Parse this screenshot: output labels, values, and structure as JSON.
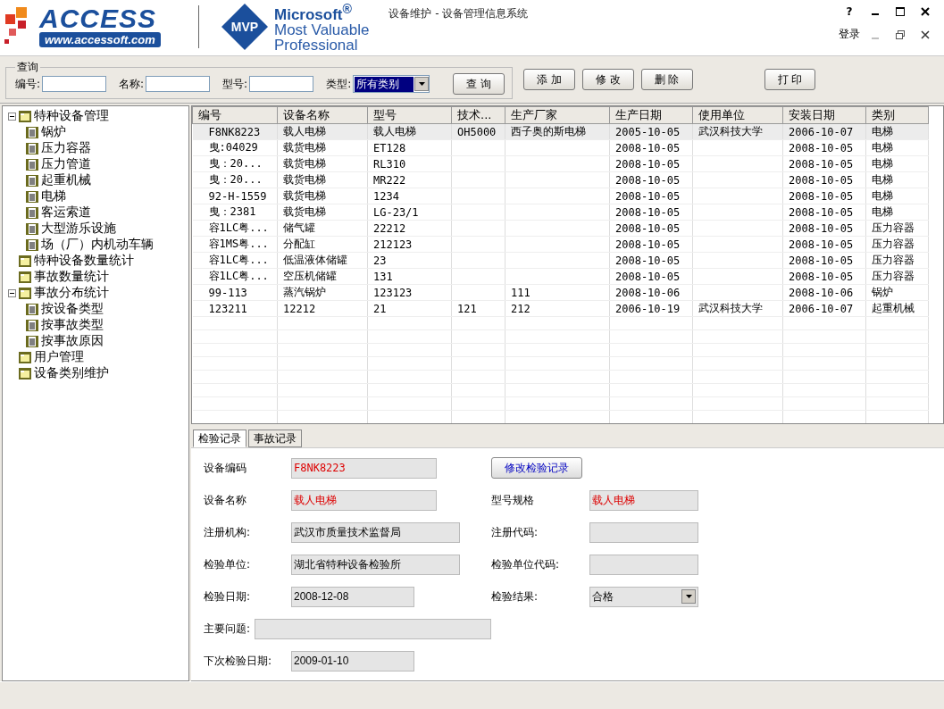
{
  "header": {
    "access_logo": {
      "name": "ACCESS",
      "url": "www.accessoft.com"
    },
    "mvp_logo": {
      "badge": "MVP",
      "lines": [
        "Microsoft$^{®}$",
        "Most Valuable",
        "Professional"
      ]
    },
    "title": "设备维护 - 设备管理信息系统",
    "help": "?",
    "login": "登录"
  },
  "query": {
    "legend": "查询",
    "fields": [
      {
        "label": "编号:",
        "kind": "input"
      },
      {
        "label": "名称:",
        "kind": "input"
      },
      {
        "label": "型号:",
        "kind": "input"
      },
      {
        "label": "类型:",
        "kind": "select",
        "value": "所有类别"
      }
    ],
    "search_button": "查 询"
  },
  "actions": [
    "添 加",
    "修 改",
    "删 除"
  ],
  "print_button": "打 印",
  "tree": [
    {
      "label": "特种设备管理",
      "expanded": true,
      "children": [
        {
          "label": "锅炉"
        },
        {
          "label": "压力容器"
        },
        {
          "label": "压力管道"
        },
        {
          "label": "起重机械"
        },
        {
          "label": "电梯"
        },
        {
          "label": "客运索道"
        },
        {
          "label": "大型游乐设施"
        },
        {
          "label": "场（厂）内机动车辆"
        }
      ]
    },
    {
      "label": "特种设备数量统计"
    },
    {
      "label": "事故数量统计"
    },
    {
      "label": "事故分布统计",
      "expanded": true,
      "children": [
        {
          "label": "按设备类型"
        },
        {
          "label": "按事故类型"
        },
        {
          "label": "按事故原因"
        }
      ]
    },
    {
      "label": "用户管理"
    },
    {
      "label": "设备类别维护"
    }
  ],
  "table": {
    "columns": [
      "编号",
      "设备名称",
      "型号",
      "技术...",
      "生产厂家",
      "生产日期",
      "使用单位",
      "安装日期",
      "类别"
    ],
    "rows": [
      {
        "selected": true,
        "cells": [
          "F8NK8223",
          "载人电梯",
          "载人电梯",
          "OH5000",
          "西子奥的斯电梯",
          "2005-10-05",
          "武汉科技大学",
          "2006-10-07",
          "电梯"
        ]
      },
      {
        "selected": false,
        "cells": [
          "曳:04029",
          "载货电梯",
          "ET128",
          "",
          "",
          "2008-10-05",
          "",
          "2008-10-05",
          "电梯"
        ]
      },
      {
        "selected": false,
        "cells": [
          "曳：20...",
          "载货电梯",
          "RL310",
          "",
          "",
          "2008-10-05",
          "",
          "2008-10-05",
          "电梯"
        ]
      },
      {
        "selected": false,
        "cells": [
          "曳：20...",
          "载货电梯",
          "MR222",
          "",
          "",
          "2008-10-05",
          "",
          "2008-10-05",
          "电梯"
        ]
      },
      {
        "selected": false,
        "cells": [
          "92-H-1559",
          "载货电梯",
          "1234",
          "",
          "",
          "2008-10-05",
          "",
          "2008-10-05",
          "电梯"
        ]
      },
      {
        "selected": false,
        "cells": [
          "曳：2381",
          "载货电梯",
          "LG-23/1",
          "",
          "",
          "2008-10-05",
          "",
          "2008-10-05",
          "电梯"
        ]
      },
      {
        "selected": false,
        "cells": [
          "容1LC粤...",
          "储气罐",
          "22212",
          "",
          "",
          "2008-10-05",
          "",
          "2008-10-05",
          "压力容器"
        ]
      },
      {
        "selected": false,
        "cells": [
          "容1MS粤...",
          "分配缸",
          "212123",
          "",
          "",
          "2008-10-05",
          "",
          "2008-10-05",
          "压力容器"
        ]
      },
      {
        "selected": false,
        "cells": [
          "容1LC粤...",
          "低温液体储罐",
          "23",
          "",
          "",
          "2008-10-05",
          "",
          "2008-10-05",
          "压力容器"
        ]
      },
      {
        "selected": false,
        "cells": [
          "容1LC粤...",
          "空压机储罐",
          "131",
          "",
          "",
          "2008-10-05",
          "",
          "2008-10-05",
          "压力容器"
        ]
      },
      {
        "selected": false,
        "cells": [
          "99-113",
          "蒸汽锅炉",
          "123123",
          "",
          "111",
          "2008-10-06",
          "",
          "2008-10-06",
          "锅炉"
        ]
      },
      {
        "selected": false,
        "cells": [
          "123211",
          "12212",
          "21",
          "121",
          "212",
          "2006-10-19",
          "武汉科技大学",
          "2006-10-07",
          "起重机械"
        ]
      }
    ]
  },
  "tabs": [
    {
      "label": "检验记录",
      "selected": true
    },
    {
      "label": "事故记录",
      "selected": false
    }
  ],
  "form": {
    "rows": [
      {
        "fields": [
          {
            "label": "设备编码",
            "value": "F8NK8223",
            "kind": "text",
            "emphasis": true
          }
        ],
        "button": "修改检验记录"
      },
      {
        "fields": [
          {
            "label": "设备名称",
            "value": "载人电梯",
            "kind": "text",
            "emphasis": true
          },
          {
            "label": "型号规格",
            "value": "载人电梯",
            "kind": "text",
            "emphasis": true
          }
        ]
      },
      {
        "fields": [
          {
            "label": "注册机构:",
            "value": "武汉市质量技术监督局",
            "kind": "text",
            "emphasis": false
          },
          {
            "label": "注册代码:",
            "kind": "text"
          }
        ]
      },
      {
        "fields": [
          {
            "label": "检验单位:",
            "value": "湖北省特种设备检验所",
            "kind": "text",
            "emphasis": false
          },
          {
            "label": "检验单位代码:",
            "kind": "text"
          }
        ]
      },
      {
        "fields": [
          {
            "label": "检验日期:",
            "value": "2008-12-08",
            "kind": "date",
            "emphasis": false
          },
          {
            "label": "检验结果:",
            "value": "合格",
            "kind": "select",
            "emphasis": false
          }
        ]
      },
      {
        "fields": [
          {
            "label": "主要问题:",
            "kind": "text"
          }
        ]
      },
      {
        "fields": [
          {
            "label": "下次检验日期:",
            "value": "2009-01-10",
            "kind": "date",
            "emphasis": false
          }
        ]
      }
    ]
  }
}
